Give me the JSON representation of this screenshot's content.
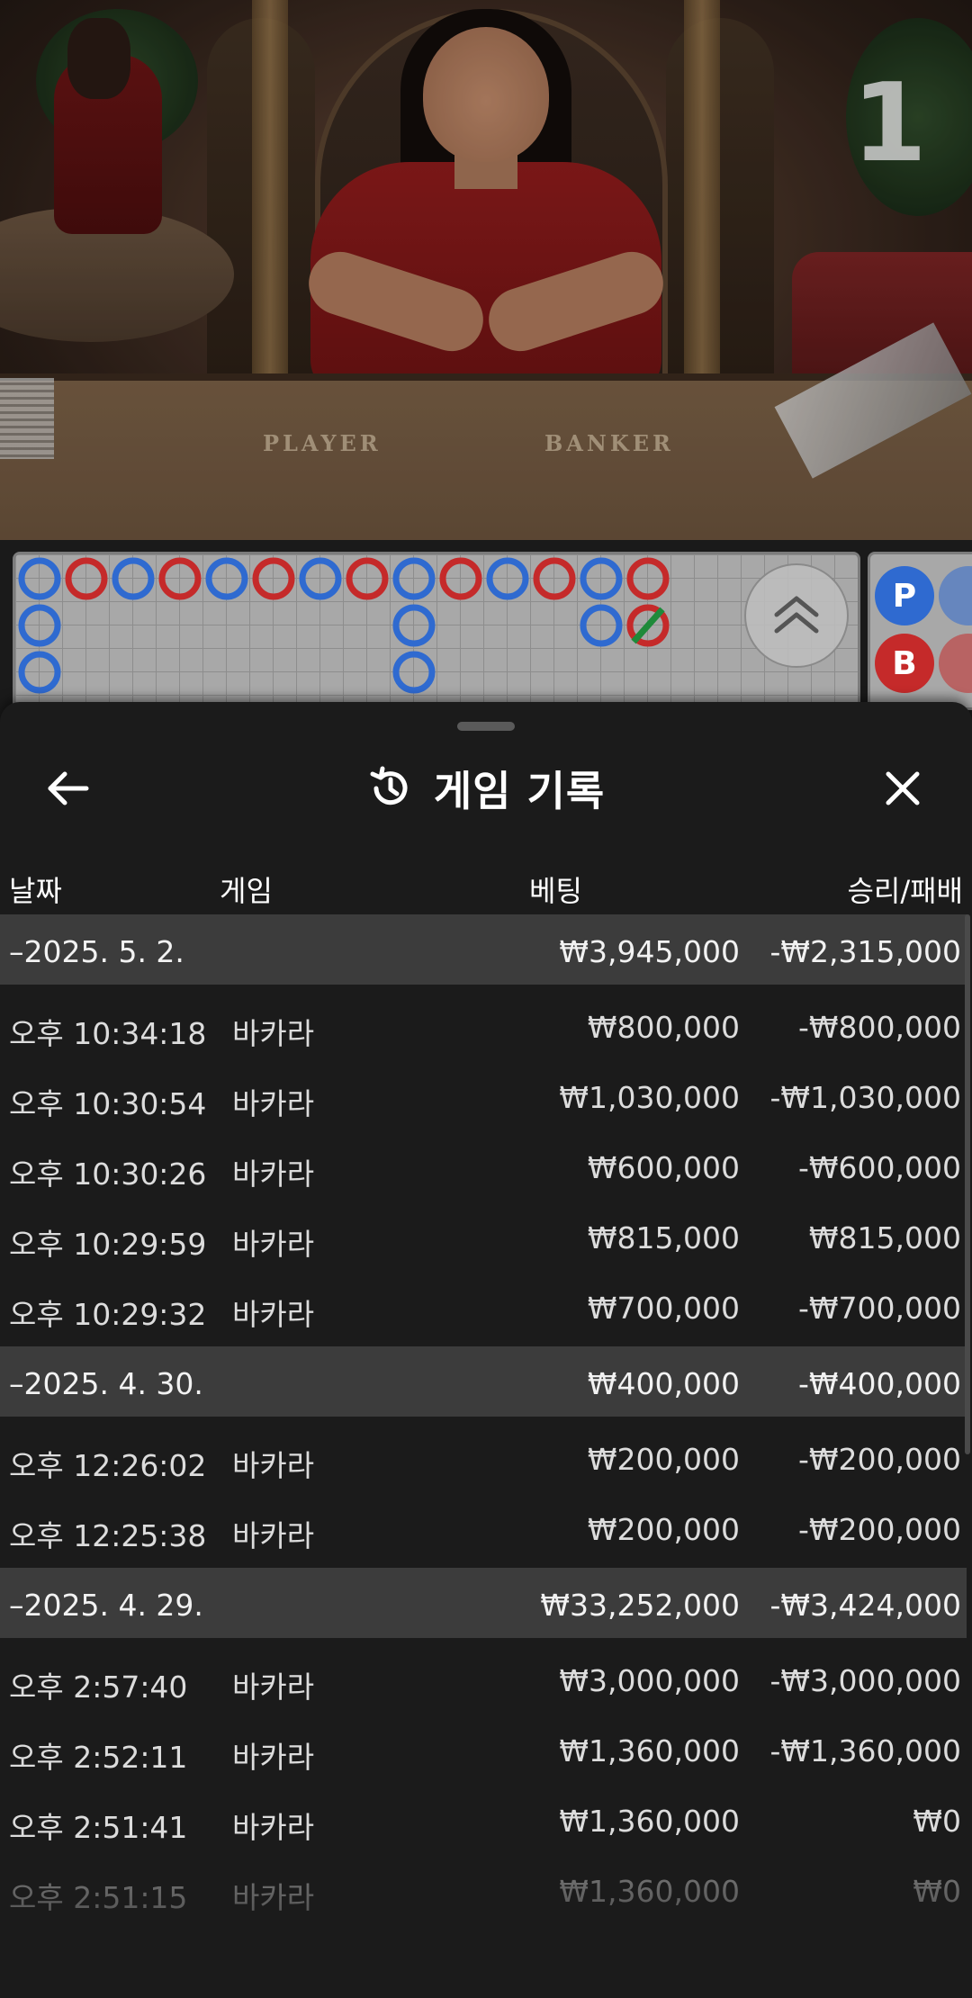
{
  "video": {
    "round_number": "1",
    "felt_player": "PLAYER",
    "felt_banker": "BANKER"
  },
  "road": {
    "colors": {
      "player": "#2f6ad0",
      "banker": "#c52a2a",
      "tie": "#1e8a3a"
    },
    "side_predictions": [
      {
        "label": "P",
        "side": "player"
      },
      {
        "label": "B",
        "side": "banker"
      }
    ]
  },
  "sheet": {
    "title": "게임 기록",
    "icons": {
      "back": "arrow-left-icon",
      "history": "history-icon",
      "close": "close-icon"
    },
    "columns": {
      "date": "날짜",
      "game": "게임",
      "bet": "베팅",
      "result": "승리/패배"
    },
    "groups": [
      {
        "date": "–2025. 5. 2.",
        "bet_total": "₩3,945,000",
        "result_total": "-₩2,315,000",
        "items": [
          {
            "time": "오후 10:34:18",
            "game": "바카라",
            "bet": "₩800,000",
            "result": "-₩800,000"
          },
          {
            "time": "오후 10:30:54",
            "game": "바카라",
            "bet": "₩1,030,000",
            "result": "-₩1,030,000"
          },
          {
            "time": "오후 10:30:26",
            "game": "바카라",
            "bet": "₩600,000",
            "result": "-₩600,000"
          },
          {
            "time": "오후 10:29:59",
            "game": "바카라",
            "bet": "₩815,000",
            "result": "₩815,000"
          },
          {
            "time": "오후 10:29:32",
            "game": "바카라",
            "bet": "₩700,000",
            "result": "-₩700,000"
          }
        ]
      },
      {
        "date": "–2025. 4. 30.",
        "bet_total": "₩400,000",
        "result_total": "-₩400,000",
        "items": [
          {
            "time": "오후 12:26:02",
            "game": "바카라",
            "bet": "₩200,000",
            "result": "-₩200,000"
          },
          {
            "time": "오후 12:25:38",
            "game": "바카라",
            "bet": "₩200,000",
            "result": "-₩200,000"
          }
        ]
      },
      {
        "date": "–2025. 4. 29.",
        "bet_total": "₩33,252,000",
        "result_total": "-₩3,424,000",
        "items": [
          {
            "time": "오후 2:57:40",
            "game": "바카라",
            "bet": "₩3,000,000",
            "result": "-₩3,000,000"
          },
          {
            "time": "오후 2:52:11",
            "game": "바카라",
            "bet": "₩1,360,000",
            "result": "-₩1,360,000"
          },
          {
            "time": "오후 2:51:41",
            "game": "바카라",
            "bet": "₩1,360,000",
            "result": "₩0"
          },
          {
            "time": "오후 2:51:15",
            "game": "바카라",
            "bet": "₩1,360,000",
            "result": "₩0"
          }
        ]
      }
    ]
  }
}
